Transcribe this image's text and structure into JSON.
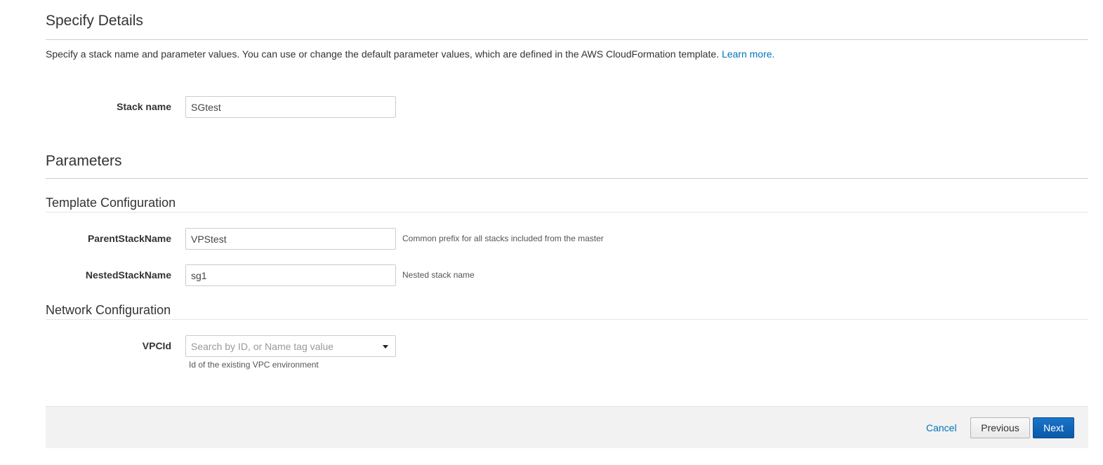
{
  "header": {
    "title": "Specify Details",
    "description": "Specify a stack name and parameter values. You can use or change the default parameter values, which are defined in the AWS CloudFormation template.",
    "learn_more": "Learn more."
  },
  "stack": {
    "label": "Stack name",
    "value": "SGtest"
  },
  "parameters": {
    "title": "Parameters",
    "template_section": {
      "title": "Template Configuration",
      "parent_stack": {
        "label": "ParentStackName",
        "value": "VPStest",
        "hint": "Common prefix for all stacks included from the master"
      },
      "nested_stack": {
        "label": "NestedStackName",
        "value": "sg1",
        "hint": "Nested stack name"
      }
    },
    "network_section": {
      "title": "Network Configuration",
      "vpc": {
        "label": "VPCId",
        "placeholder": "Search by ID, or Name tag value",
        "hint": "Id of the existing VPC environment"
      }
    }
  },
  "footer": {
    "cancel_label": "Cancel",
    "previous_label": "Previous",
    "next_label": "Next"
  },
  "colors": {
    "link": "#0073bb",
    "primary_button": "#0a5aa8",
    "footer_bg": "#f2f2f2"
  }
}
